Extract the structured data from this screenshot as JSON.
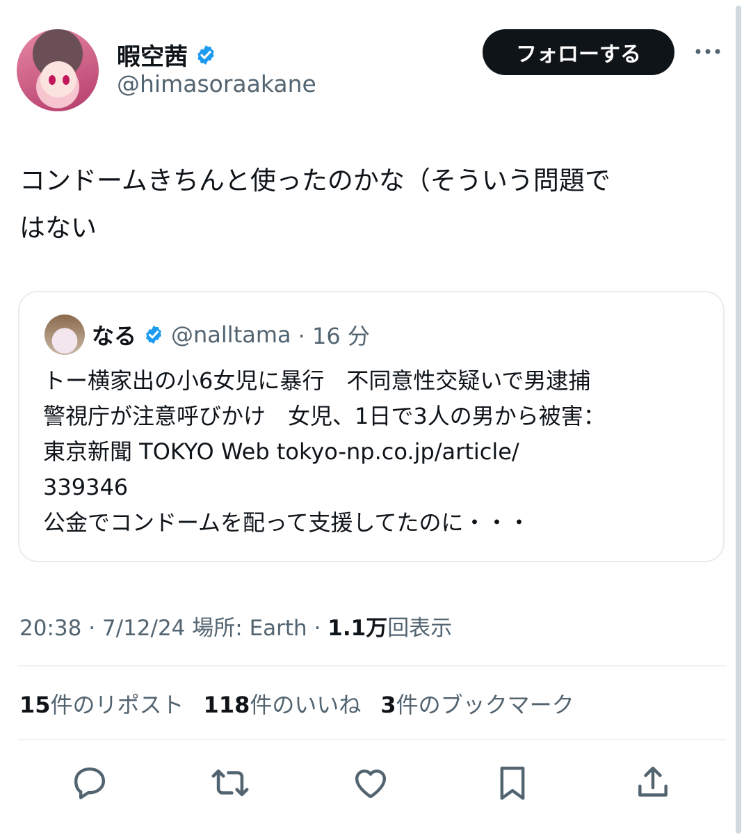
{
  "author": {
    "name": "暇空茜",
    "handle": "@himasoraakane"
  },
  "follow_button": "フォローする",
  "tweet_lines": [
    "コンドームきちんと使ったのかな（そういう問題で",
    "はない"
  ],
  "quote": {
    "name": "なる",
    "handle": "@nalltama",
    "time": "· 16 分",
    "lines": [
      "トー横家出の小6女児に暴行　不同意性交疑いで男逮捕",
      "警視庁が注意呼びかけ　女児、1日で3人の男から被害：",
      "東京新聞 TOKYO Web tokyo-np.co.jp/article/",
      "339346",
      "公金でコンドームを配って支援してたのに・・・"
    ]
  },
  "meta": {
    "time": "20:38 · 7/12/24",
    "location": "場所: Earth",
    "sep": "·",
    "views_count": "1.1万",
    "views_label": "回表示"
  },
  "stats": {
    "reposts_count": "15",
    "reposts_label": "件のリポスト",
    "likes_count": "118",
    "likes_label": "件のいいね",
    "bookmarks_count": "3",
    "bookmarks_label": "件のブックマーク"
  },
  "icons": [
    "verified-badge-icon",
    "more-icon",
    "reply-icon",
    "retweet-icon",
    "like-icon",
    "bookmark-icon",
    "share-icon"
  ],
  "colors": {
    "verified": "#1d9bf0",
    "follow_bg": "#0f1419",
    "secondary_text": "#536471"
  }
}
